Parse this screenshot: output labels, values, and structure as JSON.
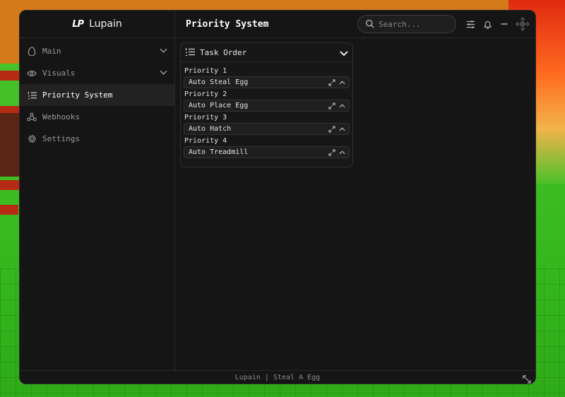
{
  "app": {
    "logo": "LP",
    "name": "Lupain"
  },
  "header": {
    "title": "Priority System",
    "search_placeholder": "Search..."
  },
  "sidebar": {
    "items": [
      {
        "label": "Main",
        "icon": "egg-icon",
        "expandable": true
      },
      {
        "label": "Visuals",
        "icon": "eye-icon",
        "expandable": true
      },
      {
        "label": "Priority System",
        "icon": "list-ordered-icon",
        "active": true
      },
      {
        "label": "Webhooks",
        "icon": "webhook-icon"
      },
      {
        "label": "Settings",
        "icon": "gear-icon"
      }
    ]
  },
  "card": {
    "title": "Task Order",
    "priorities": [
      {
        "label": "Priority 1",
        "value": "Auto Steal Egg"
      },
      {
        "label": "Priority 2",
        "value": "Auto Place Egg"
      },
      {
        "label": "Priority 3",
        "value": "Auto Hatch"
      },
      {
        "label": "Priority 4",
        "value": "Auto Treadmill"
      }
    ]
  },
  "footer": {
    "text": "Lupain | Steal A Egg"
  },
  "colors": {
    "window_bg": "#151515",
    "active_item": "#222222",
    "logo_accent": "#4a7dff"
  }
}
